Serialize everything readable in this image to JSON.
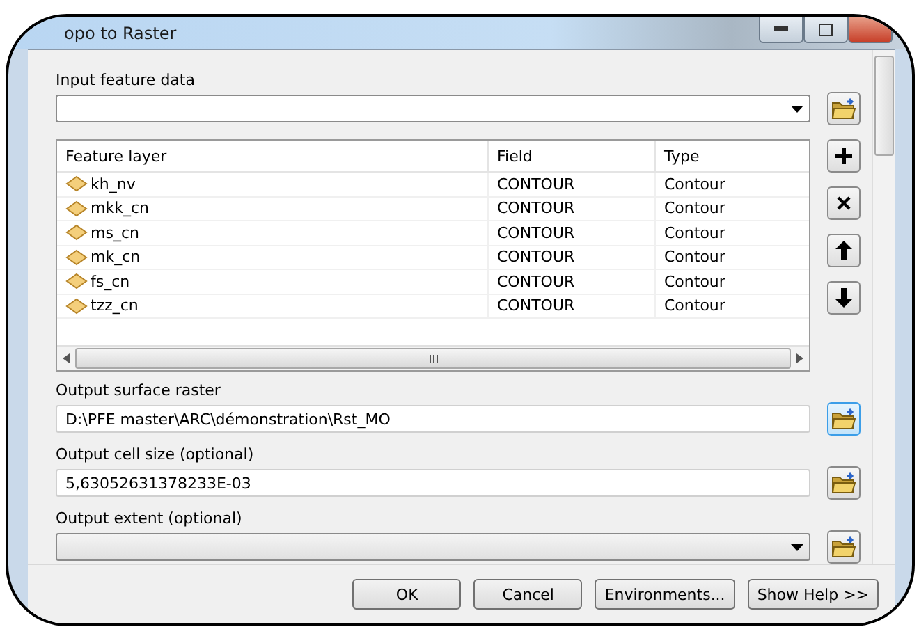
{
  "window": {
    "title": "opo to Raster"
  },
  "input_feature_data": {
    "label": "Input feature data",
    "kind": "combo",
    "focused": false,
    "disabled": false
  },
  "table": {
    "columns": [
      "Feature layer",
      "Field",
      "Type"
    ],
    "rows": [
      {
        "feature_layer": "kh_nv",
        "field": "CONTOUR",
        "type": "Contour"
      },
      {
        "feature_layer": "mkk_cn",
        "field": "CONTOUR",
        "type": "Contour"
      },
      {
        "feature_layer": "ms_cn",
        "field": "CONTOUR",
        "type": "Contour"
      },
      {
        "feature_layer": "mk_cn",
        "field": "CONTOUR",
        "type": "Contour"
      },
      {
        "feature_layer": "fs_cn",
        "field": "CONTOUR",
        "type": "Contour"
      },
      {
        "feature_layer": "tzz_cn",
        "field": "CONTOUR",
        "type": "Contour"
      }
    ]
  },
  "fields": [
    {
      "label": "Output surface raster",
      "kind": "text",
      "value": "D:\\PFE master\\ARC\\démonstration\\Rst_MO",
      "focused": true,
      "disabled": false
    },
    {
      "label": "Output cell size (optional)",
      "kind": "text",
      "value": "5,63052631378233E-03",
      "focused": false,
      "disabled": false
    },
    {
      "label": "Output extent (optional)",
      "kind": "combo",
      "focused": false,
      "disabled": true
    }
  ],
  "buttons": [
    "OK",
    "Cancel",
    "Environments...",
    "Show Help >>"
  ]
}
